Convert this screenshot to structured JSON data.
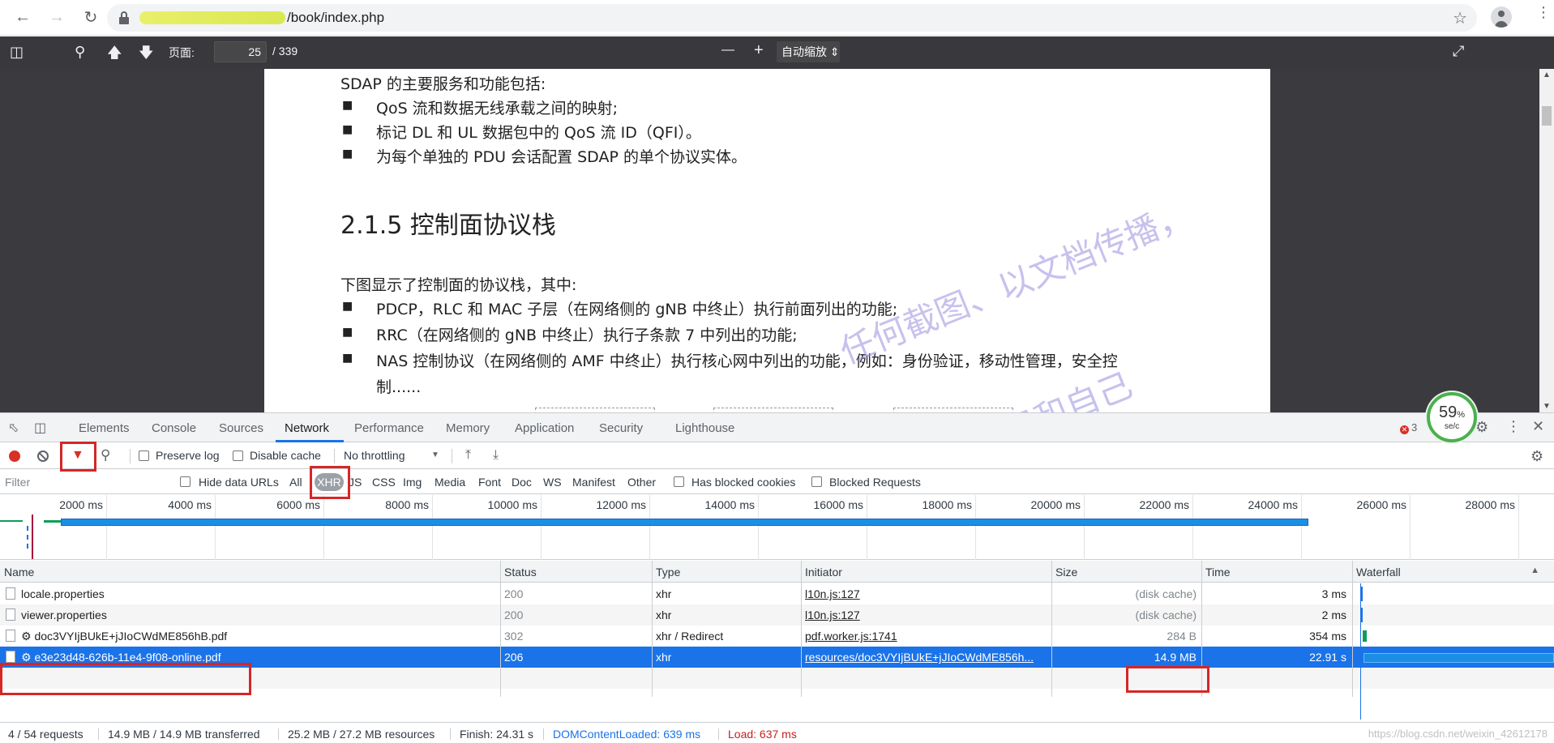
{
  "browser": {
    "url_suffix": "/book/index.php",
    "back_icon": "arrow-left-icon",
    "forward_icon": "arrow-right-icon",
    "reload_icon": "reload-icon"
  },
  "pdf_toolbar": {
    "page_label": "页面:",
    "page_number": "25",
    "page_total": "/ 339",
    "zoom_out": "—",
    "zoom_in": "+",
    "zoom_value": "自动缩放"
  },
  "pdf_page": {
    "intro": "SDAP 的主要服务和功能包括:",
    "bullets_1": [
      "QoS 流和数据无线承载之间的映射;",
      "标记 DL 和 UL 数据包中的 QoS 流 ID（QFI）。",
      "为每个单独的 PDU 会话配置 SDAP 的单个协议实体。"
    ],
    "heading": "2.1.5  控制面协议栈",
    "intro_2": "下图显示了控制面的协议栈，其中:",
    "bullets_2": [
      "PDCP，RLC 和 MAC 子层（在网络侧的 gNB 中终止）执行前面列出的功能;",
      "RRC（在网络侧的 gNB 中终止）执行子条款 7 中列出的功能;",
      "NAS 控制协议（在网络侧的 AMF 中终止）执行核心网中列出的功能，例如：身份验证，移动性管理，安全控"
    ],
    "bullet_2_cont": "制......",
    "bullet_mark": "■",
    "watermark": "任何截图、以文档传播，",
    "watermark_2": "识和自己"
  },
  "devtools": {
    "tabs": [
      "Elements",
      "Console",
      "Sources",
      "Network",
      "Performance",
      "Memory",
      "Application",
      "Security",
      "Lighthouse"
    ],
    "active_tab": "Network",
    "error_count": "3",
    "perf_badge": {
      "percent": "59",
      "percent_sign": "%",
      "speed": "se/c"
    },
    "toolbar": {
      "preserve_log": "Preserve log",
      "disable_cache": "Disable cache",
      "throttling": "No throttling"
    },
    "filterbar": {
      "placeholder": "Filter",
      "hide_data_urls": "Hide data URLs",
      "types": [
        "All",
        "XHR",
        "JS",
        "CSS",
        "Img",
        "Media",
        "Font",
        "Doc",
        "WS",
        "Manifest",
        "Other"
      ],
      "selected_type": "XHR",
      "has_blocked_cookies": "Has blocked cookies",
      "blocked_requests": "Blocked Requests"
    },
    "overview_ticks": [
      "2000 ms",
      "4000 ms",
      "6000 ms",
      "8000 ms",
      "10000 ms",
      "12000 ms",
      "14000 ms",
      "16000 ms",
      "18000 ms",
      "20000 ms",
      "22000 ms",
      "24000 ms",
      "26000 ms",
      "28000 ms"
    ],
    "columns": [
      "Name",
      "Status",
      "Type",
      "Initiator",
      "Size",
      "Time",
      "Waterfall"
    ],
    "rows": [
      {
        "name": "locale.properties",
        "status": "200",
        "type": "xhr",
        "initiator": "l10n.js:127",
        "size": "(disk cache)",
        "time": "3 ms"
      },
      {
        "name": "viewer.properties",
        "status": "200",
        "type": "xhr",
        "initiator": "l10n.js:127",
        "size": "(disk cache)",
        "time": "2 ms"
      },
      {
        "name": "⚙ doc3VYIjBUkE+jJIoCWdME856hB.pdf",
        "status": "302",
        "type": "xhr / Redirect",
        "initiator": "pdf.worker.js:1741",
        "size": "284 B",
        "time": "354 ms"
      },
      {
        "name": "⚙ e3e23d48-626b-11e4-9f08-online.pdf",
        "status": "206",
        "type": "xhr",
        "initiator": "resources/doc3VYIjBUkE+jJIoCWdME856h...",
        "size": "14.9 MB",
        "time": "22.91 s"
      }
    ],
    "selected_row": 3,
    "status_bar": {
      "requests": "4 / 54 requests",
      "transferred": "14.9 MB / 14.9 MB transferred",
      "resources": "25.2 MB / 27.2 MB resources",
      "finish": "Finish: 24.31 s",
      "dom_loaded": "DOMContentLoaded: 639 ms",
      "load": "Load: 637 ms"
    },
    "watermark": "https://blog.csdn.net/weixin_42612178"
  },
  "colors": {
    "accent": "#1a73e8",
    "highlight_box": "#d62626",
    "record": "#d93025"
  }
}
